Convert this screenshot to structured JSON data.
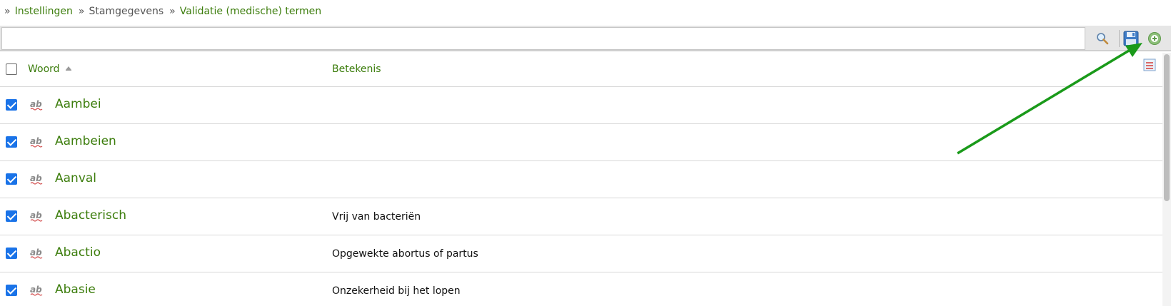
{
  "breadcrumb": {
    "sep": "»",
    "items": [
      "Instellingen",
      "Stamgegevens",
      "Validatie (medische) termen"
    ]
  },
  "toolbar": {
    "search_value": "",
    "icons": [
      "search-icon",
      "save-icon",
      "add-icon"
    ]
  },
  "table": {
    "columns": {
      "woord": "Woord",
      "betekenis": "Betekenis"
    },
    "rows": [
      {
        "word": "Aambei",
        "meaning": ""
      },
      {
        "word": "Aambeien",
        "meaning": ""
      },
      {
        "word": "Aanval",
        "meaning": ""
      },
      {
        "word": "Abacterisch",
        "meaning": "Vrij van bacteriën"
      },
      {
        "word": "Abactio",
        "meaning": "Opgewekte abortus of partus"
      },
      {
        "word": "Abasie",
        "meaning": "Onzekerheid bij het lopen"
      }
    ]
  },
  "colors": {
    "link_green": "#3c7d0c",
    "checkbox_blue": "#1a73e8",
    "arrow_green": "#1a9a1a"
  }
}
